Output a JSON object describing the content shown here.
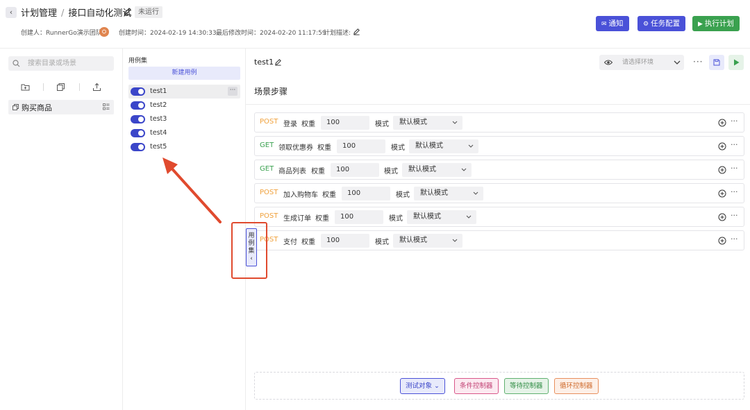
{
  "header": {
    "breadcrumb_parent": "计划管理",
    "breadcrumb_sep": "/",
    "title": "接口自动化测试",
    "status": "未运行",
    "creator_label": "创建人：",
    "creator": "RunnerGo演示团队",
    "created_label": "创建时间：",
    "created_at": "2024-02-19 14:30:33",
    "modified_label": "最后修改时间：",
    "modified_at": "2024-02-20 11:17:59",
    "desc_label": "计划描述:",
    "buttons": {
      "notify": "通知",
      "config": "任务配置",
      "run": "执行计划"
    }
  },
  "tree": {
    "search_placeholder": "搜索目录或场景",
    "items": [
      {
        "label": "购买商品"
      }
    ]
  },
  "cases": {
    "title": "用例集",
    "new_case": "新建用例",
    "items": [
      {
        "label": "test1",
        "enabled": true
      },
      {
        "label": "test2",
        "enabled": true
      },
      {
        "label": "test3",
        "enabled": true
      },
      {
        "label": "test4",
        "enabled": true
      },
      {
        "label": "test5",
        "enabled": true
      }
    ],
    "collapse_tab": [
      "用",
      "例",
      "集",
      "‹"
    ]
  },
  "scene": {
    "name": "test1",
    "env_placeholder": "请选择环境",
    "section_title": "场景步骤",
    "weight_label": "权重",
    "mode_label": "模式",
    "steps": [
      {
        "method": "POST",
        "name": "登录",
        "weight": "100",
        "mode": "默认模式"
      },
      {
        "method": "GET",
        "name": "领取优惠券",
        "weight": "100",
        "mode": "默认模式"
      },
      {
        "method": "GET",
        "name": "商品列表",
        "weight": "100",
        "mode": "默认模式"
      },
      {
        "method": "POST",
        "name": "加入购物车",
        "weight": "100",
        "mode": "默认模式"
      },
      {
        "method": "POST",
        "name": "生成订单",
        "weight": "100",
        "mode": "默认模式"
      },
      {
        "method": "POST",
        "name": "支付",
        "weight": "100",
        "mode": "默认模式"
      }
    ],
    "controllers": {
      "target": "测试对象",
      "condition": "条件控制器",
      "wait": "等待控制器",
      "loop": "循环控制器"
    }
  },
  "colors": {
    "primary": "#4a51d8",
    "success": "#3aa14f",
    "post": "#f0a13c",
    "get": "#3aa14f",
    "annotation": "#e04a2e"
  }
}
